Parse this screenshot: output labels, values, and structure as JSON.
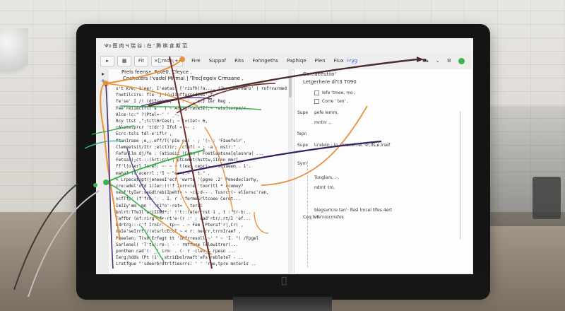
{
  "window": {
    "title": "Ψ൦ 图 肉 Ч 瑞 谷 : 在 ' 腾 棋 食 斯 范",
    "toolbar": {
      "fit_label": "Fit",
      "zoom_label": "×[;mdn;+·",
      "menu": [
        "Fire",
        "Suppof",
        "Rits",
        "Fonngeths",
        "Paphiqe",
        "Plen",
        "Fiux"
      ],
      "fiux_badge": "i·ryg"
    }
  },
  "editor": {
    "header": "Prels feens•, Fpte0, Cfeyce ,",
    "header2": "Cocheters !'vadel Mirmal ] 'Trec[egeiv Crmsane ,",
    "lines": [
      "s't  k7e, 1'eer, I'eatas, ['rzsfh(?a..., (Jurstfurnaro' | rofrvarmed",
      "fnetilcirs: fle  '} !(uIinffarsed(ds',t,",
      "fe'se' I /! (dt7se'/r,   ',     ! ' ,'c(}  Ier Reg ,",
      "Fee'reiIectrl('s   ' (  ~ Arurg-rate5I(;~ •ate]cerpe/r",
      "Alce·!c:\" ?)Ptel=·' ' _~.",
      "Rcy ltst ,\";tctl0rIes(; ~ (<(Iet~ 6,",
      "cAlstetprcr 't(dr'] Ifol  < ~-  ;",
      "Ecrc-tsls tdl-e'iflr ,",
      "ftunIraee  ;e,;.eff/T('pIe oq(  · ; '(~ : 'Fauefelr',",
      "Clemeetsit/Itr ;elct)tr; 'clef( ~ ; ·a  ·  mstr:\"   .",
      "Fefsnllm dj/fe :  (atiosit  !Comn  |  Foetlaatsna[qlesnra( ...",
      "Fetsal(;ct-::(5rt:rcl   | ptLomet(hsttw,iInnn mmr[...",
      "ff'l(o:erl Iaref: ~·  ~  ~ t(eas cepri~  ~  sCIaeem..  1'.",
      "mahaf (l'acerrl  ;'5   ~     \"e:'t.~  ;  t.\"  ,",
      "<  Lrpecatopt(jeneeeI'ecf 'ewrte '(pgne  .2'  Penedeclarhy,",
      "cre:wdel'ofd 1(Ier:!!'f Ixrr<!e   'toor(tl  *  rcomuy?",
      "neaf'tyIar:ve&dtrebiIpehtv  ~ ~cr:d-- .  Tusrcr(~ elIersc'ran,",
      "ncfTfp: (f'frm·'- .  I.  r  -:ferme&rltcoee Ceret...",
      "ImIIy'mm  ·mn ' .tI\"o'·ret= '  teral",
      "bnlrt:TTeIl'ariIIWd*;'  !'t::(aterrrst 1  ,  t  :'tr·b:..",
      "Faffbr (ef:rirg :f+·rt'e·(r  :' ;  dad'rtr/.rt/I  'ef...",
      "Edrtrg::·c'f IrnIr:·  tp~~  . ~  Fem  ,Pteraf'r|,Cr(    ,",
      "neIe'seIrrt'/(ntsrlcEctI   ~    <  r: ne(rr,trrnIraef  ,",
      "Pbeelen;  T(s0'Erfegt  tt  'IHfrresoll   ~'   \"  ~ 'I. \"(  /Fpgel",
      "Sarlenel(   'T'tc!:re-:  · ·   rmffmne Telewitrer(...",
      "ponthen  cad'(·  _' irm·  . (·  r ·clet_&  rpesn  ...",
      "Ierg;hdds (Pt  (1'  ,stri£bolrmaft'efs  reblete7 -  ..",
      "Lratfgue   \"'sdeerbrdtrlfiesrrs: '    ' 'rae,tpre    mnterIs  .."
    ]
  },
  "panel": {
    "title": "Coreaeeutiio'",
    "subtitle": "Letgerhere  dl't3 T090",
    "rows": [
      "Iefe 'tmee, mo ;",
      "Corre ' ten' ,",
      "pefe  Iemm,",
      "mntnr  ,,",
      "lu'eleln :  (n :fsraeel:ret ·e:,lfs,e.lrsef",
      "Tonglem, ;-,",
      "ndmt ·Im,",
      "blegsvrlcre  tan'·  lfesl  lrncel  tlfes 4ert",
      "vfe'n\\ocmsfos",
      "Ceq:hm"
    ],
    "side_labels": [
      "Supe",
      "fepn",
      "Supe",
      "Sym"
    ]
  },
  "colors": {
    "orange": "#e8903a",
    "green": "#38b24a",
    "purple": "#4b2a78",
    "brown": "#6b2e2e",
    "teal": "#3ab3a0"
  }
}
